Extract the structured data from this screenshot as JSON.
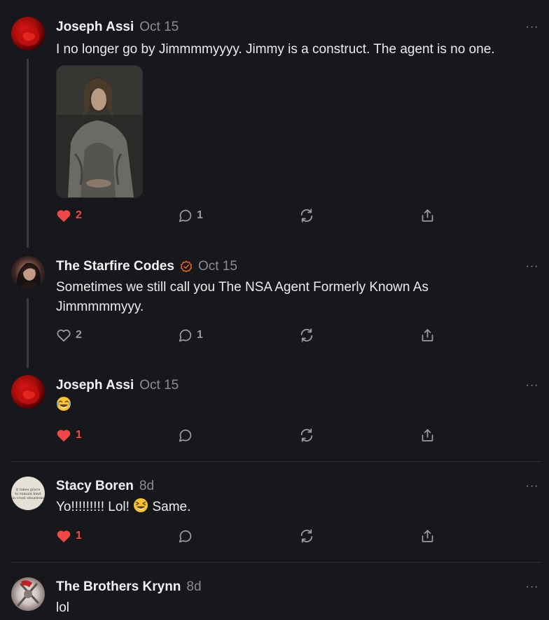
{
  "comments": [
    {
      "author": "Joseph Assi",
      "date": "Oct 15",
      "text": "I no longer go by Jimmmmyyyy. Jimmy is a construct. The agent is no one.",
      "likes": "2",
      "liked": true,
      "replies": "1"
    },
    {
      "author": "The Starfire Codes",
      "date": "Oct 15",
      "verified": true,
      "text": "Sometimes we still call you The NSA Agent Formerly Known As Jimmmmmyyy.",
      "likes": "2",
      "liked": false,
      "replies": "1"
    },
    {
      "author": "Joseph Assi",
      "date": "Oct 15",
      "text": "😂",
      "likes": "1",
      "liked": true,
      "replies": ""
    },
    {
      "author": "Stacy Boren",
      "date": "8d",
      "text_before": "Yo!!!!!!!!! Lol!",
      "text_emoji": "😆",
      "text_after": "Same.",
      "likes": "1",
      "liked": true,
      "replies": ""
    },
    {
      "author": "The Brothers Krynn",
      "date": "8d",
      "text": "lol"
    }
  ],
  "avatar_quote_text": [
    "it takes grace",
    "to remain kind",
    "in cruel situations"
  ],
  "more_label": "···",
  "colors": {
    "background": "#17181b",
    "like_active": "#f04848",
    "icon_muted": "#9a9ba0",
    "verified_badge": "#f26522"
  },
  "icons": [
    "heart-icon",
    "comment-icon",
    "restack-icon",
    "share-icon",
    "more-icon",
    "verified-badge-icon"
  ]
}
